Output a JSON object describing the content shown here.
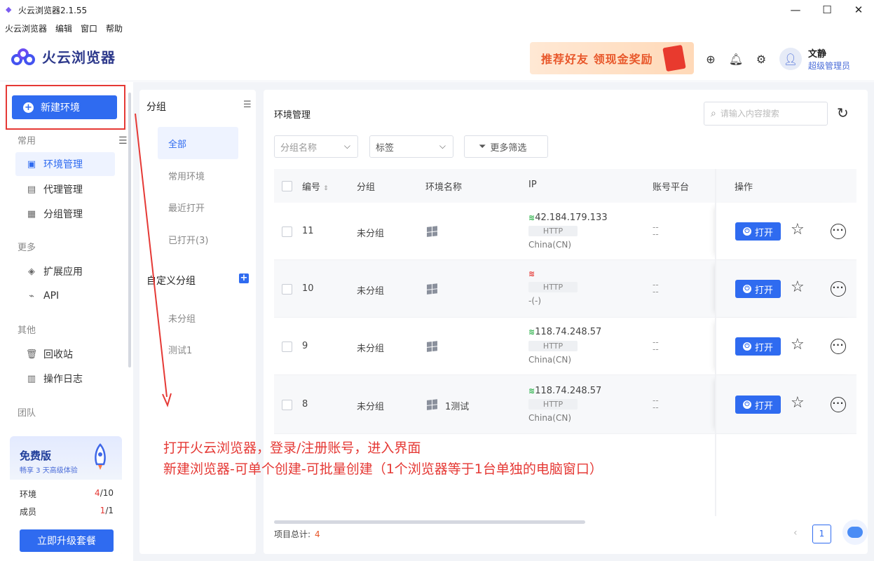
{
  "window": {
    "title": "火云浏览器2.1.55",
    "controls": {
      "minimize": "—",
      "maximize": "☐",
      "close": "✕"
    }
  },
  "menubar": [
    "火云浏览器",
    "编辑",
    "窗口",
    "帮助"
  ],
  "header": {
    "logo_text": "火云浏览器",
    "promo_text": "推荐好友 领现金奖励",
    "user_name": "文静",
    "user_role": "超级管理员"
  },
  "sidebar": {
    "new_env_label": "新建环境",
    "sections": {
      "common": "常用",
      "more": "更多",
      "other": "其他",
      "team": "团队"
    },
    "items": [
      {
        "label": "环境管理",
        "icon": "gear-box-icon",
        "active": true
      },
      {
        "label": "代理管理",
        "icon": "server-icon",
        "active": false
      },
      {
        "label": "分组管理",
        "icon": "folder-icon",
        "active": false
      },
      {
        "label": "扩展应用",
        "icon": "cube-icon",
        "active": false
      },
      {
        "label": "API",
        "icon": "plug-icon",
        "active": false
      },
      {
        "label": "回收站",
        "icon": "trash-icon",
        "active": false
      },
      {
        "label": "操作日志",
        "icon": "log-icon",
        "active": false
      }
    ],
    "plan": {
      "title": "免费版",
      "subtitle": "畅享 3 天高级体验",
      "env_label": "环境",
      "env_used": "4",
      "env_total": "/10",
      "member_label": "成员",
      "member_used": "1",
      "member_total": "/1",
      "upgrade_label": "立即升级套餐"
    }
  },
  "groups": {
    "title": "分组",
    "items": [
      "全部",
      "常用环境",
      "最近打开",
      "已打开(3)"
    ],
    "custom_title": "自定义分组",
    "custom_items": [
      "未分组",
      "测试1"
    ]
  },
  "main": {
    "title": "环境管理",
    "search_placeholder": "请输入内容搜索",
    "filters": {
      "group_placeholder": "分组名称",
      "tag": "标签",
      "more": "更多筛选"
    },
    "columns": [
      "编号",
      "分组",
      "环境名称",
      "IP",
      "账号平台",
      "操作"
    ],
    "rows": [
      {
        "id": "11",
        "group": "未分组",
        "name": "",
        "ip": "42.184.179.133",
        "proto": "HTTP",
        "country": "China(CN)",
        "online": true
      },
      {
        "id": "10",
        "group": "未分组",
        "name": "",
        "ip": "",
        "proto": "HTTP",
        "country": "-(-)",
        "online": false
      },
      {
        "id": "9",
        "group": "未分组",
        "name": "",
        "ip": "118.74.248.57",
        "proto": "HTTP",
        "country": "China(CN)",
        "online": true
      },
      {
        "id": "8",
        "group": "未分组",
        "name": "1测试",
        "ip": "118.74.248.57",
        "proto": "HTTP",
        "country": "China(CN)",
        "online": true
      }
    ],
    "open_label": "打开",
    "dash": "--",
    "total_label": "项目总计:",
    "total_value": "4",
    "page": "1"
  },
  "annotations": [
    "打开火云浏览器，登录/注册账号，进入界面",
    "新建浏览器-可单个创建-可批量创建（1个浏览器等于1台单独的电脑窗口）"
  ],
  "colors": {
    "primary": "#2f6bf0",
    "annotation": "#e53935",
    "online": "#2fb24c"
  }
}
